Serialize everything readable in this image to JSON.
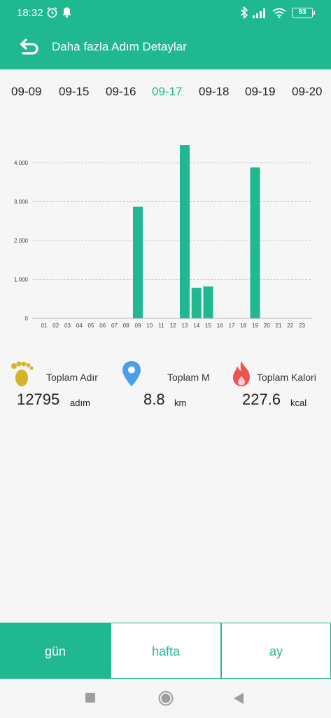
{
  "status_bar": {
    "time": "18:32",
    "battery": "93",
    "icons": [
      "alarm-icon",
      "notification-bell-icon",
      "bluetooth-icon",
      "signal-icon",
      "wifi-icon",
      "battery-icon"
    ]
  },
  "header": {
    "title": "Daha fazla Adım Detaylar",
    "back_icon": "back-arrow-icon",
    "color": "#20b890"
  },
  "dates": {
    "items": [
      "09-09",
      "09-15",
      "09-16",
      "09-17",
      "09-18",
      "09-19",
      "09-20"
    ],
    "selected": "09-17",
    "active_color": "#20b890"
  },
  "chart_data": {
    "type": "bar",
    "categories": [
      "01",
      "02",
      "03",
      "04",
      "05",
      "06",
      "07",
      "08",
      "09",
      "10",
      "11",
      "12",
      "13",
      "14",
      "15",
      "16",
      "17",
      "18",
      "19",
      "20",
      "21",
      "22",
      "23"
    ],
    "values": [
      0,
      0,
      0,
      0,
      0,
      0,
      0,
      0,
      2870,
      0,
      0,
      0,
      4450,
      780,
      820,
      0,
      0,
      0,
      3880,
      0,
      0,
      0,
      0
    ],
    "y_ticks": [
      "0",
      "1.000",
      "2.000",
      "3.000",
      "4.000"
    ],
    "ylim": [
      0,
      4500
    ],
    "grid": true,
    "bar_color": "#20b890"
  },
  "stats": [
    {
      "label": "Toplam Adım",
      "value": "12795",
      "unit": "adım",
      "icon": "footprint-icon"
    },
    {
      "label": "Toplam Mesafe",
      "value": "8.8",
      "unit": "km",
      "icon": "location-pin-icon"
    },
    {
      "label": "Toplam Kalori",
      "value": "227.6",
      "unit": "kcal",
      "icon": "fire-icon"
    }
  ],
  "period_tabs": {
    "day": "gün",
    "week": "hafta",
    "month": "ay",
    "selected": "gün"
  },
  "nav_bar": {
    "icons": [
      "recent-apps-icon",
      "home-icon",
      "back-icon"
    ]
  }
}
